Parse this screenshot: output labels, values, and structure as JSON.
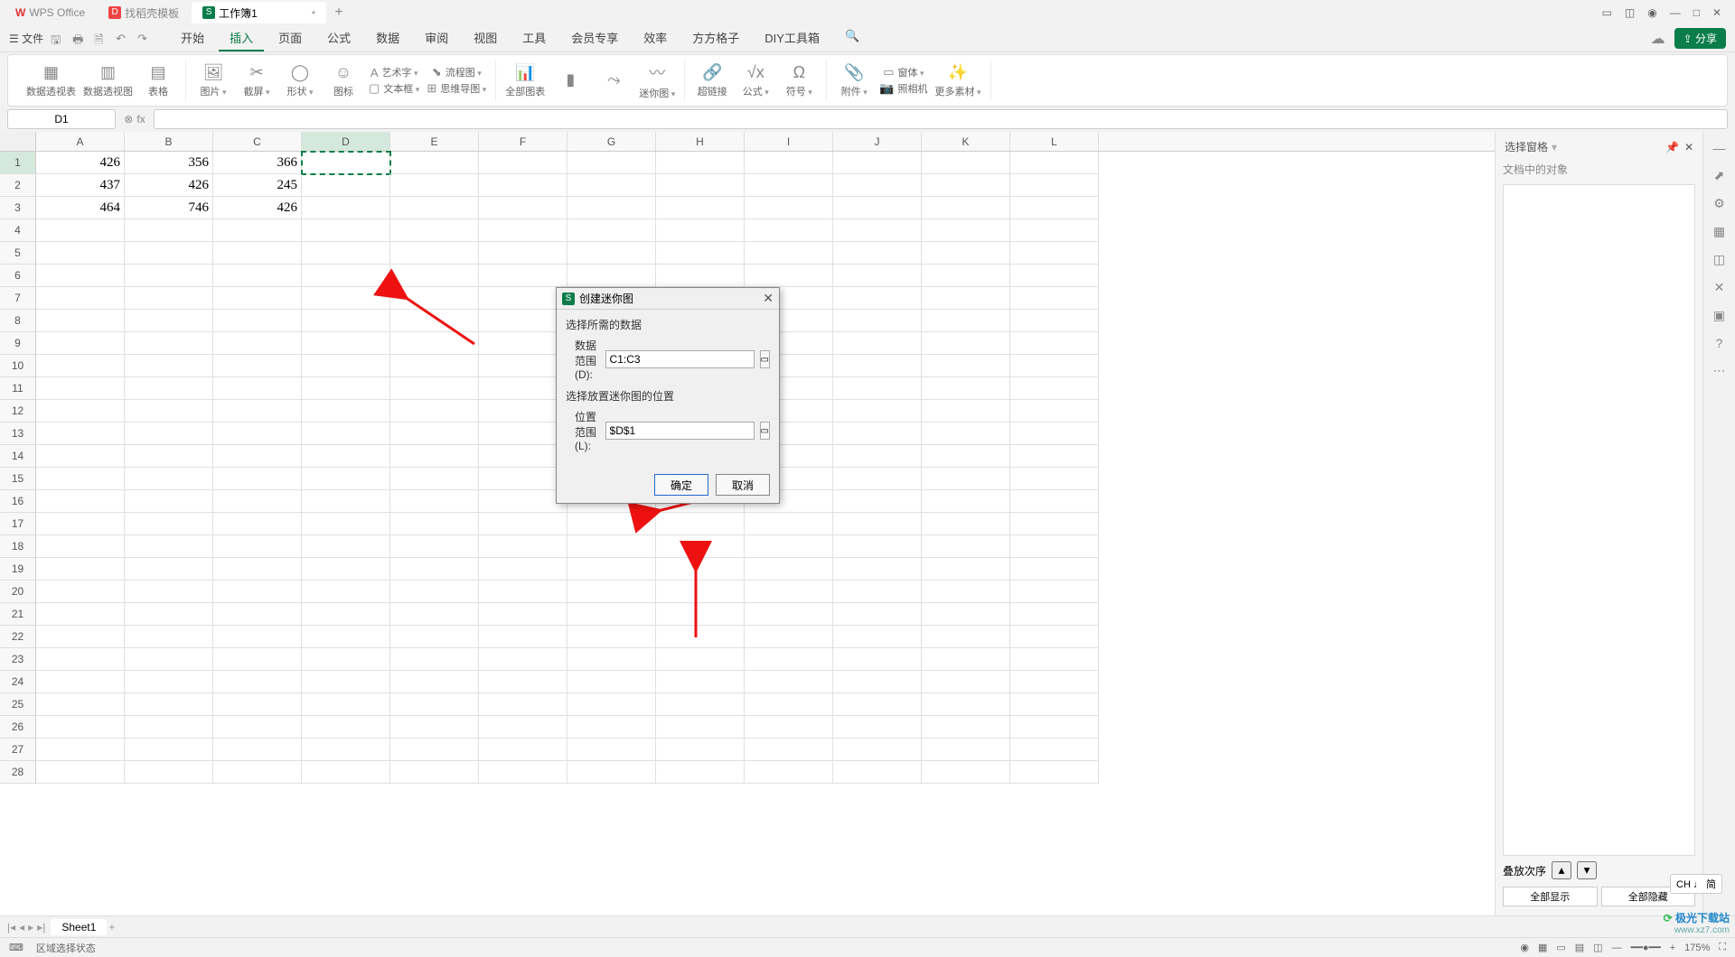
{
  "titlebar": {
    "app": "WPS Office",
    "tab_template": "找稻壳模板",
    "tab_workbook": "工作簿1"
  },
  "menubar": {
    "file": "文件",
    "tabs": [
      "开始",
      "插入",
      "页面",
      "公式",
      "数据",
      "审阅",
      "视图",
      "工具",
      "会员专享",
      "效率",
      "方方格子",
      "DIY工具箱"
    ],
    "active_index": 1,
    "share": "分享"
  },
  "ribbon": {
    "pivot_table": "数据透视表",
    "pivot_chart": "数据透视图",
    "table": "表格",
    "picture": "图片",
    "screenshot": "截屏",
    "shapes": "形状",
    "icons": "图标",
    "wordart": "艺术字",
    "textbox": "文本框",
    "flowchart": "流程图",
    "mindmap": "思维导图",
    "all_charts": "全部图表",
    "chart_presets": "",
    "sparkline": "迷你图",
    "hyperlink": "超链接",
    "formula": "公式",
    "symbol": "符号",
    "attachment": "附件",
    "object": "窗体",
    "camera": "照相机",
    "more": "更多素材"
  },
  "formula": {
    "name_box": "D1",
    "fx": "fx"
  },
  "sheet": {
    "columns": [
      "A",
      "B",
      "C",
      "D",
      "E",
      "F",
      "G",
      "H",
      "I",
      "J",
      "K",
      "L"
    ],
    "selected_col": "D",
    "rows": 28,
    "data": {
      "A1": "426",
      "B1": "356",
      "C1": "366",
      "A2": "437",
      "B2": "426",
      "C2": "245",
      "A3": "464",
      "B3": "746",
      "C3": "426"
    },
    "selected_cell": "D1"
  },
  "dialog": {
    "title": "创建迷你图",
    "section1": "选择所需的数据",
    "data_label": "数据范围(D):",
    "data_value": "C1:C3",
    "section2": "选择放置迷你图的位置",
    "loc_label": "位置范围(L):",
    "loc_value": "$D$1",
    "ok": "确定",
    "cancel": "取消"
  },
  "right_panel": {
    "title": "选择窗格",
    "subtitle": "文档中的对象",
    "sort": "叠放次序",
    "show_all": "全部显示",
    "hide_all": "全部隐藏"
  },
  "sheet_tabs": {
    "sheet1": "Sheet1"
  },
  "status": {
    "mode": "区域选择状态",
    "zoom": "175%"
  },
  "ime": "CH ♩ 简",
  "watermark": {
    "name": "极光下载站",
    "url": "www.xz7.com"
  }
}
